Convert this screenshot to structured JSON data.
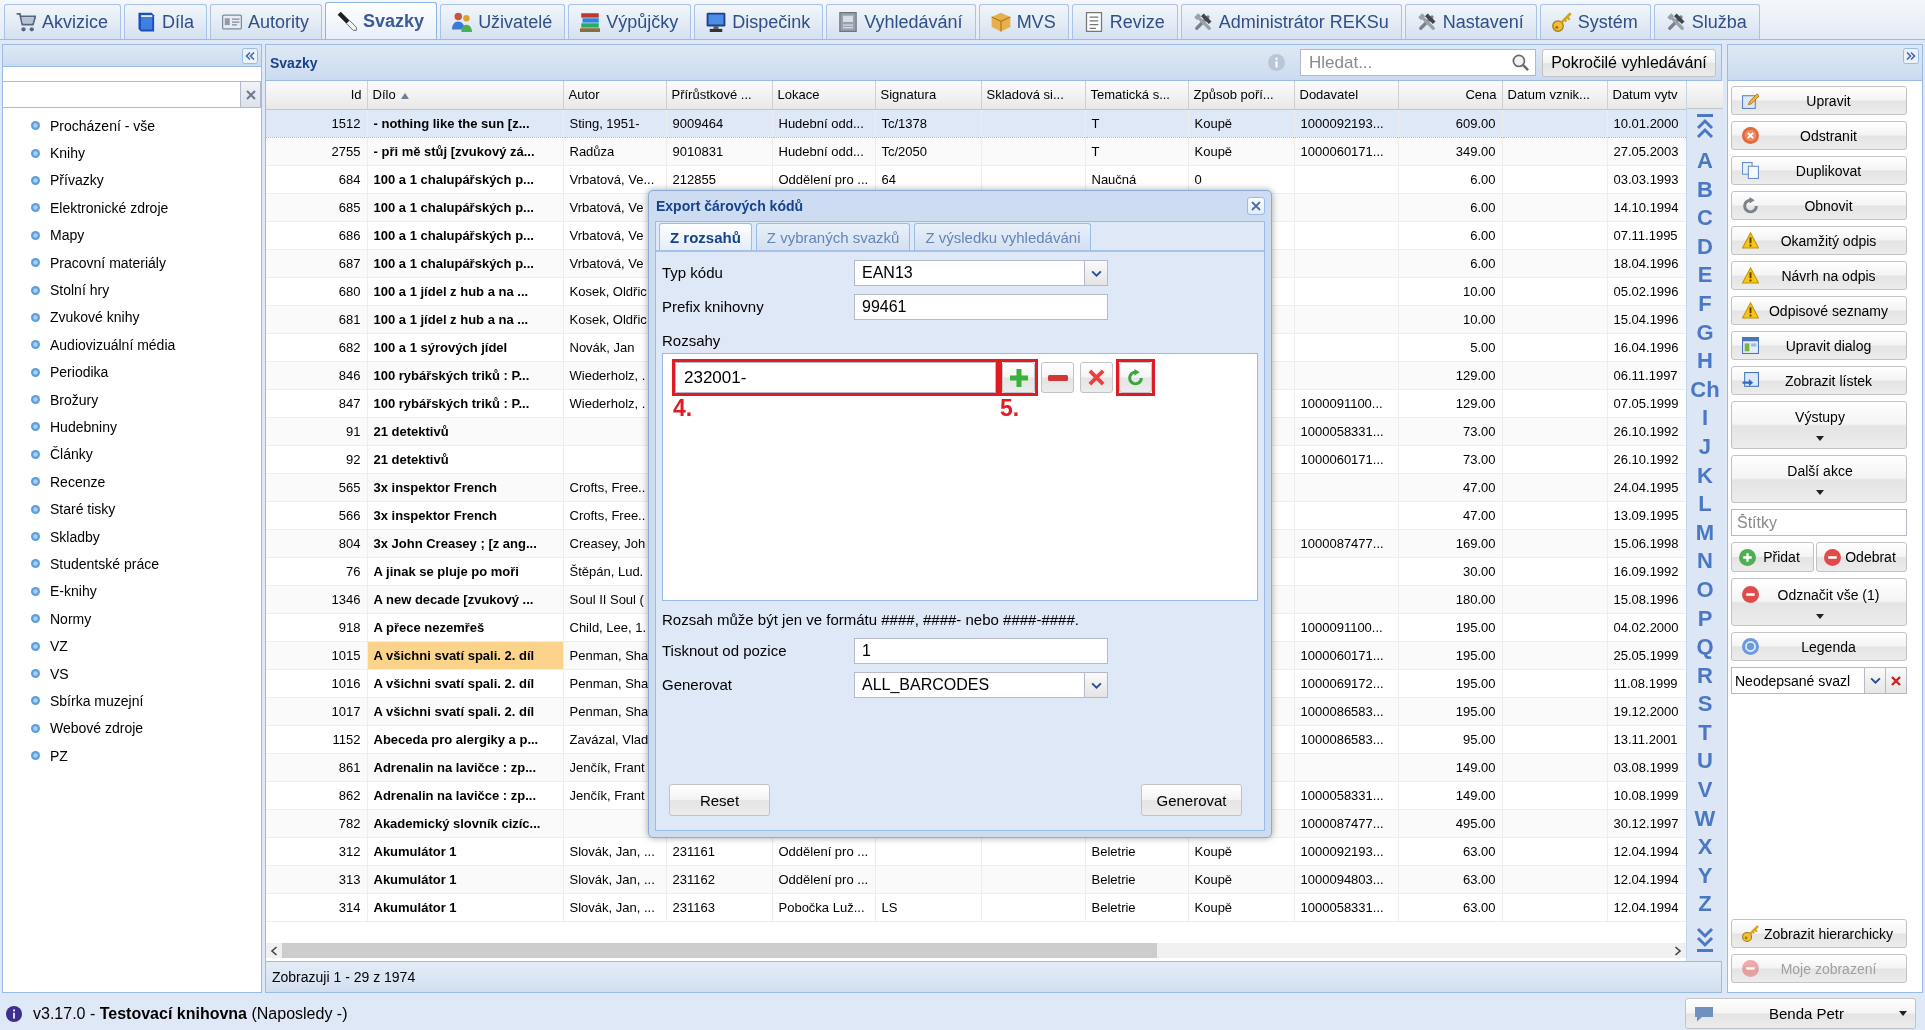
{
  "tabs": [
    {
      "label": "Akvizice",
      "selected": false
    },
    {
      "label": "Díla",
      "selected": false
    },
    {
      "label": "Autority",
      "selected": false
    },
    {
      "label": "Svazky",
      "selected": true
    },
    {
      "label": "Uživatelé",
      "selected": false
    },
    {
      "label": "Výpůjčky",
      "selected": false
    },
    {
      "label": "Dispečink",
      "selected": false
    },
    {
      "label": "Vyhledávání",
      "selected": false
    },
    {
      "label": "MVS",
      "selected": false
    },
    {
      "label": "Revize",
      "selected": false
    },
    {
      "label": "Administrátor REKSu",
      "selected": false
    },
    {
      "label": "Nastavení",
      "selected": false
    },
    {
      "label": "Systém",
      "selected": false
    },
    {
      "label": "Služba",
      "selected": false
    }
  ],
  "sidebar": {
    "items": [
      {
        "label": "Procházení - vše",
        "selected": false
      },
      {
        "label": "Knihy",
        "selected": false
      },
      {
        "label": "Přívazky",
        "selected": false
      },
      {
        "label": "Elektronické zdroje",
        "selected": false
      },
      {
        "label": "Mapy",
        "selected": false
      },
      {
        "label": "Pracovní materiály",
        "selected": false
      },
      {
        "label": "Stolní hry",
        "selected": false
      },
      {
        "label": "Zvukové knihy",
        "selected": false
      },
      {
        "label": "Audiovizuální média",
        "selected": false
      },
      {
        "label": "Periodika",
        "selected": false
      },
      {
        "label": "Brožury",
        "selected": false
      },
      {
        "label": "Hudebniny",
        "selected": false
      },
      {
        "label": "Články",
        "selected": false
      },
      {
        "label": "Recenze",
        "selected": false
      },
      {
        "label": "Staré tisky",
        "selected": false
      },
      {
        "label": "Skladby",
        "selected": false
      },
      {
        "label": "Studentské práce",
        "selected": false
      },
      {
        "label": "E-knihy",
        "selected": false
      },
      {
        "label": "Normy",
        "selected": false
      },
      {
        "label": "VZ",
        "selected": false
      },
      {
        "label": "VS",
        "selected": false
      },
      {
        "label": "Sbírka muzejní",
        "selected": false
      },
      {
        "label": "Webové zdroje",
        "selected": false
      },
      {
        "label": "PZ",
        "selected": false
      }
    ]
  },
  "panel": {
    "title": "Svazky",
    "search_placeholder": "Hledat...",
    "advanced_search": "Pokročilé vyhledávání"
  },
  "table": {
    "columns": [
      {
        "label": "Id",
        "kind": "number",
        "sorted": false
      },
      {
        "label": "Dílo",
        "kind": "title",
        "sorted": true
      },
      {
        "label": "Autor",
        "kind": "text",
        "sorted": false
      },
      {
        "label": "Přírůstkové ...",
        "kind": "text",
        "sorted": false
      },
      {
        "label": "Lokace",
        "kind": "text",
        "sorted": false
      },
      {
        "label": "Signatura",
        "kind": "text",
        "sorted": false
      },
      {
        "label": "Skladová si...",
        "kind": "text",
        "sorted": false
      },
      {
        "label": "Tematická s...",
        "kind": "text",
        "sorted": false
      },
      {
        "label": "Způsob poří...",
        "kind": "text",
        "sorted": false
      },
      {
        "label": "Dodavatel",
        "kind": "text",
        "sorted": false
      },
      {
        "label": "Cena",
        "kind": "number",
        "sorted": false
      },
      {
        "label": "Datum vznik...",
        "kind": "text",
        "sorted": false
      },
      {
        "label": "Datum vytv",
        "kind": "text",
        "sorted": false
      }
    ],
    "rows": [
      {
        "selected": true,
        "highlighted": false,
        "cells": [
          "1512",
          "- nothing like the sun [z...",
          "Sting, 1951-",
          "9009464",
          "Hudební odd...",
          "Tc/1378",
          null,
          "T",
          "Koupě",
          "1000092193...",
          "609.00",
          null,
          "10.01.2000"
        ]
      },
      {
        "selected": false,
        "highlighted": false,
        "cells": [
          "2755",
          "- při mě stůj [zvukový zá...",
          "Radůza",
          "9010831",
          "Hudební odd...",
          "Tc/2050",
          null,
          "T",
          "Koupě",
          "1000060171...",
          "349.00",
          null,
          "27.05.2003"
        ]
      },
      {
        "selected": false,
        "highlighted": false,
        "cells": [
          "684",
          "100 a 1 chalupářských p...",
          "Vrbatová, Ve...",
          "212855",
          "Oddělení pro ...",
          "64",
          null,
          "Naučná",
          "0",
          null,
          "6.00",
          null,
          "03.03.1993"
        ]
      },
      {
        "selected": false,
        "highlighted": false,
        "cells": [
          "685",
          "100 a 1 chalupářských p...",
          "Vrbatová, Ve",
          null,
          null,
          null,
          null,
          null,
          null,
          null,
          "6.00",
          null,
          "14.10.1994"
        ]
      },
      {
        "selected": false,
        "highlighted": false,
        "cells": [
          "686",
          "100 a 1 chalupářských p...",
          "Vrbatová, Ve",
          null,
          null,
          null,
          null,
          null,
          null,
          null,
          "6.00",
          null,
          "07.11.1995"
        ]
      },
      {
        "selected": false,
        "highlighted": false,
        "cells": [
          "687",
          "100 a 1 chalupářských p...",
          "Vrbatová, Ve",
          null,
          null,
          null,
          null,
          null,
          null,
          null,
          "6.00",
          null,
          "18.04.1996"
        ]
      },
      {
        "selected": false,
        "highlighted": false,
        "cells": [
          "680",
          "100 a 1 jídel z hub a na ...",
          "Kosek, Oldřic",
          null,
          null,
          null,
          null,
          null,
          null,
          null,
          "10.00",
          null,
          "05.02.1996"
        ]
      },
      {
        "selected": false,
        "highlighted": false,
        "cells": [
          "681",
          "100 a 1 jídel z hub a na ...",
          "Kosek, Oldřic",
          null,
          null,
          null,
          null,
          null,
          null,
          null,
          "10.00",
          null,
          "15.04.1996"
        ]
      },
      {
        "selected": false,
        "highlighted": false,
        "cells": [
          "682",
          "100 a 1 sýrových jídel",
          "Novák, Jan",
          null,
          null,
          null,
          null,
          null,
          null,
          null,
          "5.00",
          null,
          "16.04.1996"
        ]
      },
      {
        "selected": false,
        "highlighted": false,
        "cells": [
          "846",
          "100 rybářských triků : P...",
          "Wiederholz, .",
          null,
          null,
          null,
          null,
          null,
          null,
          null,
          "129.00",
          null,
          "06.11.1997"
        ]
      },
      {
        "selected": false,
        "highlighted": false,
        "cells": [
          "847",
          "100 rybářských triků : P...",
          "Wiederholz, .",
          null,
          null,
          null,
          null,
          null,
          null,
          "1000091100...",
          "129.00",
          null,
          "07.05.1999"
        ]
      },
      {
        "selected": false,
        "highlighted": false,
        "cells": [
          "91",
          "21 detektivů",
          null,
          null,
          null,
          null,
          null,
          null,
          null,
          "1000058331...",
          "73.00",
          null,
          "26.10.1992"
        ]
      },
      {
        "selected": false,
        "highlighted": false,
        "cells": [
          "92",
          "21 detektivů",
          null,
          null,
          null,
          null,
          null,
          null,
          null,
          "1000060171...",
          "73.00",
          null,
          "26.10.1992"
        ]
      },
      {
        "selected": false,
        "highlighted": false,
        "cells": [
          "565",
          "3x inspektor French",
          "Crofts, Free..",
          null,
          null,
          null,
          null,
          null,
          null,
          null,
          "47.00",
          null,
          "24.04.1995"
        ]
      },
      {
        "selected": false,
        "highlighted": false,
        "cells": [
          "566",
          "3x inspektor French",
          "Crofts, Free..",
          null,
          null,
          null,
          null,
          null,
          null,
          null,
          "47.00",
          null,
          "13.09.1995"
        ]
      },
      {
        "selected": false,
        "highlighted": false,
        "cells": [
          "804",
          "3x John Creasey ; [z ang...",
          "Creasey, Joh",
          null,
          null,
          null,
          null,
          null,
          null,
          "1000087477...",
          "169.00",
          null,
          "15.06.1998"
        ]
      },
      {
        "selected": false,
        "highlighted": false,
        "cells": [
          "76",
          "A jinak se pluje po moři",
          "Štěpán, Lud.",
          null,
          null,
          null,
          null,
          null,
          null,
          null,
          "30.00",
          null,
          "16.09.1992"
        ]
      },
      {
        "selected": false,
        "highlighted": false,
        "cells": [
          "1346",
          "A new decade [zvukový ...",
          "Soul II Soul (",
          null,
          null,
          null,
          null,
          null,
          null,
          null,
          "180.00",
          null,
          "15.08.1996"
        ]
      },
      {
        "selected": false,
        "highlighted": false,
        "cells": [
          "918",
          "A přece nezemřeš",
          "Child, Lee, 1.",
          null,
          null,
          null,
          null,
          null,
          null,
          "1000091100...",
          "195.00",
          null,
          "04.02.2000"
        ]
      },
      {
        "selected": false,
        "highlighted": true,
        "cells": [
          "1015",
          "A všichni svatí spali. 2. díl",
          "Penman, Sha",
          null,
          null,
          null,
          null,
          null,
          null,
          "1000060171...",
          "195.00",
          null,
          "25.05.1999"
        ]
      },
      {
        "selected": false,
        "highlighted": false,
        "cells": [
          "1016",
          "A všichni svatí spali. 2. díl",
          "Penman, Sha",
          null,
          null,
          null,
          null,
          null,
          null,
          "1000069172...",
          "195.00",
          null,
          "11.08.1999"
        ]
      },
      {
        "selected": false,
        "highlighted": false,
        "cells": [
          "1017",
          "A všichni svatí spali. 2. díl",
          "Penman, Sha",
          null,
          null,
          null,
          null,
          null,
          null,
          "1000086583...",
          "195.00",
          null,
          "19.12.2000"
        ]
      },
      {
        "selected": false,
        "highlighted": false,
        "cells": [
          "1152",
          "Abeceda pro alergiky a p...",
          "Zavázal, Vlad",
          null,
          null,
          null,
          null,
          null,
          null,
          "1000086583...",
          "95.00",
          null,
          "13.11.2001"
        ]
      },
      {
        "selected": false,
        "highlighted": false,
        "cells": [
          "861",
          "Adrenalin na lavičce : zp...",
          "Jenčík, Frant",
          null,
          null,
          null,
          null,
          null,
          null,
          null,
          "149.00",
          null,
          "03.08.1999"
        ]
      },
      {
        "selected": false,
        "highlighted": false,
        "cells": [
          "862",
          "Adrenalin na lavičce : zp...",
          "Jenčík, Frant",
          null,
          null,
          null,
          null,
          null,
          null,
          "1000058331...",
          "149.00",
          null,
          "10.08.1999"
        ]
      },
      {
        "selected": false,
        "highlighted": false,
        "cells": [
          "782",
          "Akademický slovník cizíc...",
          null,
          null,
          null,
          null,
          null,
          null,
          null,
          "1000087477...",
          "495.00",
          null,
          "30.12.1997"
        ]
      },
      {
        "selected": false,
        "highlighted": false,
        "cells": [
          "312",
          "Akumulátor 1",
          "Slovák, Jan, ...",
          "231161",
          "Oddělení pro ...",
          null,
          null,
          "Beletrie",
          "Koupě",
          "1000092193...",
          "63.00",
          null,
          "12.04.1994"
        ]
      },
      {
        "selected": false,
        "highlighted": false,
        "cells": [
          "313",
          "Akumulátor 1",
          "Slovák, Jan, ...",
          "231162",
          "Oddělení pro ...",
          null,
          null,
          "Beletrie",
          "Koupě",
          "1000094803...",
          "63.00",
          null,
          "12.04.1994"
        ]
      },
      {
        "selected": false,
        "highlighted": false,
        "cells": [
          "314",
          "Akumulátor 1",
          "Slovák, Jan, ...",
          "231163",
          "Pobočka Luž...",
          "LS",
          null,
          "Beletrie",
          "Koupě",
          "1000058331...",
          "63.00",
          null,
          "12.04.1994"
        ]
      }
    ]
  },
  "alphabet": {
    "letters": [
      "A",
      "B",
      "C",
      "D",
      "E",
      "F",
      "G",
      "H",
      "Ch",
      "I",
      "J",
      "K",
      "L",
      "M",
      "N",
      "O",
      "P",
      "Q",
      "R",
      "S",
      "T",
      "U",
      "V",
      "W",
      "X",
      "Y",
      "Z"
    ]
  },
  "footer": "Zobrazuji 1 - 29 z 1974",
  "actions": [
    {
      "kind": "button",
      "label": "Upravit",
      "disabled": false
    },
    {
      "kind": "button",
      "label": "Odstranit",
      "disabled": false
    },
    {
      "kind": "button",
      "label": "Duplikovat",
      "disabled": false
    },
    {
      "kind": "button",
      "label": "Obnovit",
      "disabled": false
    },
    {
      "kind": "button",
      "label": "Okamžitý odpis",
      "disabled": false
    },
    {
      "kind": "button",
      "label": "Návrh na odpis",
      "disabled": false
    },
    {
      "kind": "button",
      "label": "Odpisové seznamy",
      "disabled": false
    },
    {
      "kind": "button",
      "label": "Upravit dialog",
      "disabled": false
    },
    {
      "kind": "button",
      "label": "Zobrazit lístek",
      "disabled": false
    },
    {
      "kind": "menu",
      "label": "Výstupy",
      "disabled": false
    },
    {
      "kind": "menu",
      "label": "Další akce",
      "disabled": false
    },
    {
      "kind": "field",
      "placeholder": "Štítky"
    },
    {
      "kind": "pair",
      "buttons": [
        {
          "label": "Přidat",
          "disabled": false
        },
        {
          "label": "Odebrat",
          "disabled": false
        }
      ]
    },
    {
      "kind": "menu",
      "label": "Odznačit vše (1)",
      "disabled": false
    },
    {
      "kind": "button",
      "label": "Legenda",
      "disabled": false
    },
    {
      "kind": "combo",
      "value": "Neodepsané svazl"
    }
  ],
  "bottom_actions": [
    {
      "label": "Zobrazit hierarchicky",
      "disabled": false
    },
    {
      "label": "Moje zobrazení",
      "disabled": true
    }
  ],
  "dialog": {
    "title": "Export čárových kódů",
    "tabs": [
      {
        "label": "Z rozsahů",
        "selected": true
      },
      {
        "label": "Z vybraných svazků",
        "selected": false
      },
      {
        "label": "Z výsledku vyhledáváni",
        "selected": false
      }
    ],
    "fields": [
      {
        "kind": "combo",
        "label": "Typ kódu",
        "value": "EAN13"
      },
      {
        "kind": "text",
        "label": "Prefix knihovny",
        "value": "99461"
      }
    ],
    "ranges": {
      "label": "Rozsahy",
      "input": {
        "value": "232001-",
        "highlighted": true,
        "annotation": "4."
      },
      "buttons": [
        {
          "kind": "add",
          "highlighted": true,
          "annotation": "5."
        },
        {
          "kind": "remove",
          "highlighted": false
        },
        {
          "kind": "delete",
          "highlighted": false
        },
        {
          "kind": "refresh",
          "highlighted": true
        }
      ]
    },
    "hint": "Rozsah může být jen ve formátu ####, ####- nebo ####-####.",
    "options": [
      {
        "kind": "text",
        "label": "Tisknout od pozice",
        "value": "1"
      },
      {
        "kind": "combo",
        "label": "Generovat",
        "value": "ALL_BARCODES"
      }
    ],
    "buttons": [
      {
        "label": "Reset"
      },
      {
        "label": "Generovat"
      }
    ]
  },
  "status_bar": {
    "text": "v3.17.0 - **Testovací knihovna** (Naposledy -)",
    "user": "Benda Petr"
  }
}
